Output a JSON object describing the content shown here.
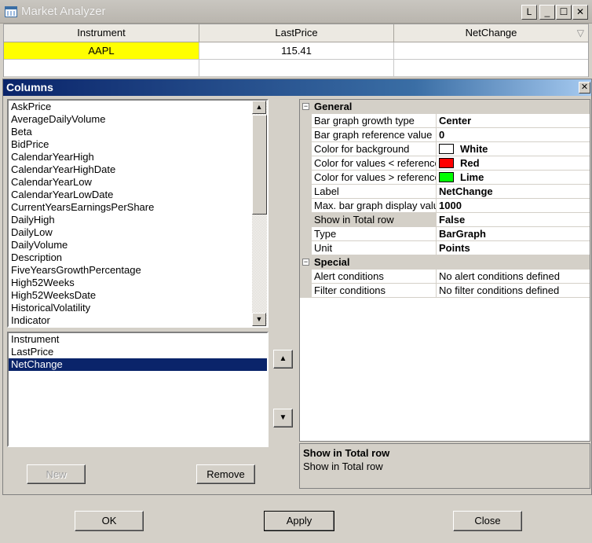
{
  "window": {
    "title": "Market Analyzer",
    "buttons": {
      "link": "L",
      "minimize": "_",
      "maximize": "☐",
      "close": "✕"
    }
  },
  "grid": {
    "columns": [
      "Instrument",
      "LastPrice",
      "NetChange"
    ],
    "sort_indicator": "▽",
    "rows": [
      {
        "instrument": "AAPL",
        "last_price": "115.41",
        "net_change": ""
      },
      {
        "instrument": "",
        "last_price": "",
        "net_change": ""
      }
    ],
    "highlight_color": "#ffff00"
  },
  "dialog": {
    "title": "Columns",
    "close": "✕",
    "available": [
      "AskPrice",
      "AverageDailyVolume",
      "Beta",
      "BidPrice",
      "CalendarYearHigh",
      "CalendarYearHighDate",
      "CalendarYearLow",
      "CalendarYearLowDate",
      "CurrentYearsEarningsPerShare",
      "DailyHigh",
      "DailyLow",
      "DailyVolume",
      "Description",
      "FiveYearsGrowthPercentage",
      "High52Weeks",
      "High52WeeksDate",
      "HistoricalVolatility",
      "Indicator"
    ],
    "selected": [
      "Instrument",
      "LastPrice",
      "NetChange"
    ],
    "selected_index": 2,
    "new_button": "New",
    "remove_button": "Remove",
    "move_up_icon": "arrow-up",
    "move_down_icon": "arrow-down",
    "properties": {
      "categories": [
        {
          "name": "General",
          "expander": "⊟",
          "rows": [
            {
              "name": "Bar graph growth type",
              "value": "Center",
              "bold": true
            },
            {
              "name": "Bar graph reference value",
              "value": "0",
              "bold": true
            },
            {
              "name": "Color for background",
              "value": "White",
              "bold": true,
              "color": "#ffffff"
            },
            {
              "name": "Color for values < reference",
              "value": "Red",
              "bold": true,
              "color": "#ff0000"
            },
            {
              "name": "Color for values > reference",
              "value": "Lime",
              "bold": true,
              "color": "#00ff00"
            },
            {
              "name": "Label",
              "value": "NetChange",
              "bold": true
            },
            {
              "name": "Max. bar graph display value",
              "value": "1000",
              "bold": true
            },
            {
              "name": "Show in Total row",
              "value": "False",
              "bold": true,
              "highlighted": true
            },
            {
              "name": "Type",
              "value": "BarGraph",
              "bold": true
            },
            {
              "name": "Unit",
              "value": "Points",
              "bold": true
            }
          ]
        },
        {
          "name": "Special",
          "expander": "⊟",
          "rows": [
            {
              "name": "Alert conditions",
              "value": "No alert conditions defined",
              "bold": false
            },
            {
              "name": "Filter conditions",
              "value": "No filter conditions defined",
              "bold": false
            }
          ]
        }
      ]
    },
    "description": {
      "title": "Show in Total row",
      "text": "Show in Total row"
    }
  },
  "footer": {
    "ok": "OK",
    "apply": "Apply",
    "close": "Close"
  }
}
